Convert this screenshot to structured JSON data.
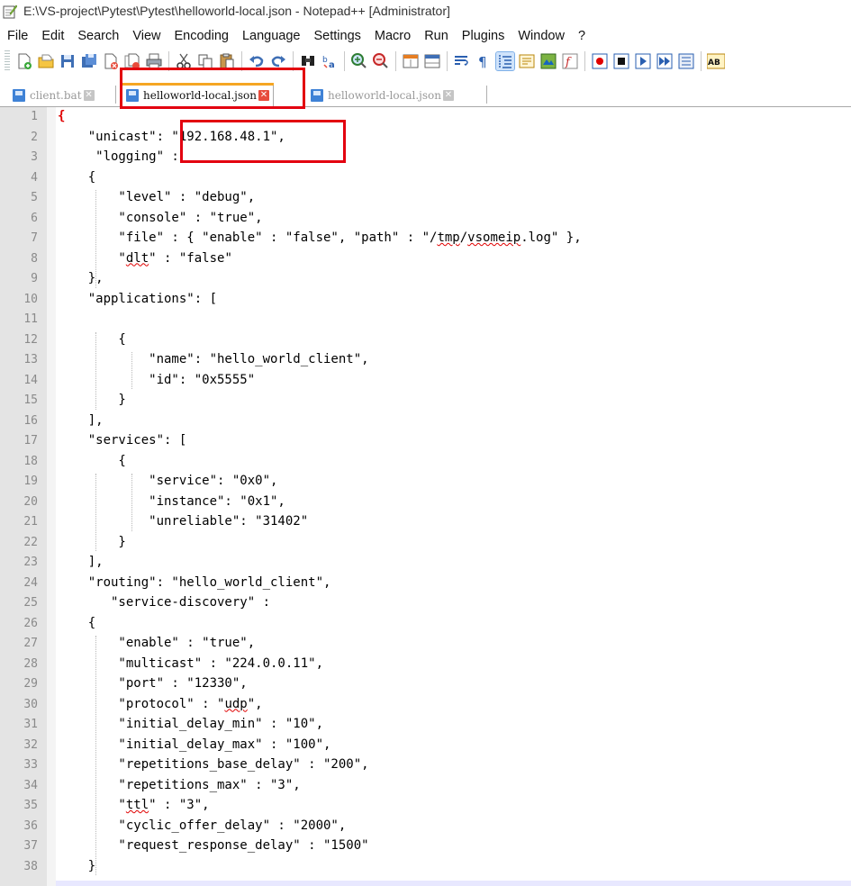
{
  "window": {
    "title": "E:\\VS-project\\Pytest\\Pytest\\helloworld-local.json - Notepad++ [Administrator]"
  },
  "menu": [
    "File",
    "Edit",
    "Search",
    "View",
    "Encoding",
    "Language",
    "Settings",
    "Macro",
    "Run",
    "Plugins",
    "Window",
    "?"
  ],
  "tabs": [
    {
      "label": "client.bat",
      "active": false
    },
    {
      "label": "helloworld-local.json",
      "active": true
    },
    {
      "label": "helloworld-local.json",
      "active": false
    }
  ],
  "editor": {
    "lines": [
      {
        "n": "1",
        "text": "{"
      },
      {
        "n": "2",
        "text": "    \"unicast\": \"192.168.48.1\","
      },
      {
        "n": "3",
        "text": "     \"logging\" :"
      },
      {
        "n": "4",
        "text": "    {"
      },
      {
        "n": "5",
        "text": "        \"level\" : \"debug\","
      },
      {
        "n": "6",
        "text": "        \"console\" : \"true\","
      },
      {
        "n": "7",
        "text": "        \"file\" : { \"enable\" : \"false\", \"path\" : \"/tmp/vsomeip.log\" },"
      },
      {
        "n": "8",
        "text": "        \"dlt\" : \"false\""
      },
      {
        "n": "9",
        "text": "    },"
      },
      {
        "n": "10",
        "text": "    \"applications\": ["
      },
      {
        "n": "11",
        "text": ""
      },
      {
        "n": "12",
        "text": "        {"
      },
      {
        "n": "13",
        "text": "            \"name\": \"hello_world_client\","
      },
      {
        "n": "14",
        "text": "            \"id\": \"0x5555\""
      },
      {
        "n": "15",
        "text": "        }"
      },
      {
        "n": "16",
        "text": "    ],"
      },
      {
        "n": "17",
        "text": "    \"services\": ["
      },
      {
        "n": "18",
        "text": "        {"
      },
      {
        "n": "19",
        "text": "            \"service\": \"0x0\","
      },
      {
        "n": "20",
        "text": "            \"instance\": \"0x1\","
      },
      {
        "n": "21",
        "text": "            \"unreliable\": \"31402\""
      },
      {
        "n": "22",
        "text": "        }"
      },
      {
        "n": "23",
        "text": "    ],"
      },
      {
        "n": "24",
        "text": "    \"routing\": \"hello_world_client\","
      },
      {
        "n": "25",
        "text": "       \"service-discovery\" :"
      },
      {
        "n": "26",
        "text": "    {"
      },
      {
        "n": "27",
        "text": "        \"enable\" : \"true\","
      },
      {
        "n": "28",
        "text": "        \"multicast\" : \"224.0.0.11\","
      },
      {
        "n": "29",
        "text": "        \"port\" : \"12330\","
      },
      {
        "n": "30",
        "text": "        \"protocol\" : \"udp\","
      },
      {
        "n": "31",
        "text": "        \"initial_delay_min\" : \"10\","
      },
      {
        "n": "32",
        "text": "        \"initial_delay_max\" : \"100\","
      },
      {
        "n": "33",
        "text": "        \"repetitions_base_delay\" : \"200\","
      },
      {
        "n": "34",
        "text": "        \"repetitions_max\" : \"3\","
      },
      {
        "n": "35",
        "text": "        \"ttl\" : \"3\","
      },
      {
        "n": "36",
        "text": "        \"cyclic_offer_delay\" : \"2000\","
      },
      {
        "n": "37",
        "text": "        \"request_response_delay\" : \"1500\""
      },
      {
        "n": "38",
        "text": "    }"
      }
    ]
  },
  "colors": {
    "annotation": "#e3000f",
    "active_tab_accent": "#f5a623",
    "brace": "#e00000"
  },
  "toolbar_icons": [
    "new-file-icon",
    "open-file-icon",
    "save-icon",
    "save-all-icon",
    "close-icon",
    "close-all-icon",
    "print-icon",
    "cut-icon",
    "copy-icon",
    "paste-icon",
    "undo-icon",
    "redo-icon",
    "find-icon",
    "replace-icon",
    "zoom-in-icon",
    "zoom-out-icon",
    "sync-vertical-icon",
    "sync-horizontal-icon",
    "word-wrap-icon",
    "show-all-chars-icon",
    "indent-guide-icon",
    "user-lang-icon",
    "doc-map-icon",
    "function-list-icon",
    "record-macro-icon",
    "stop-macro-icon",
    "play-macro-icon",
    "run-macro-multiple-icon",
    "save-macro-icon",
    "spellcheck-icon"
  ]
}
